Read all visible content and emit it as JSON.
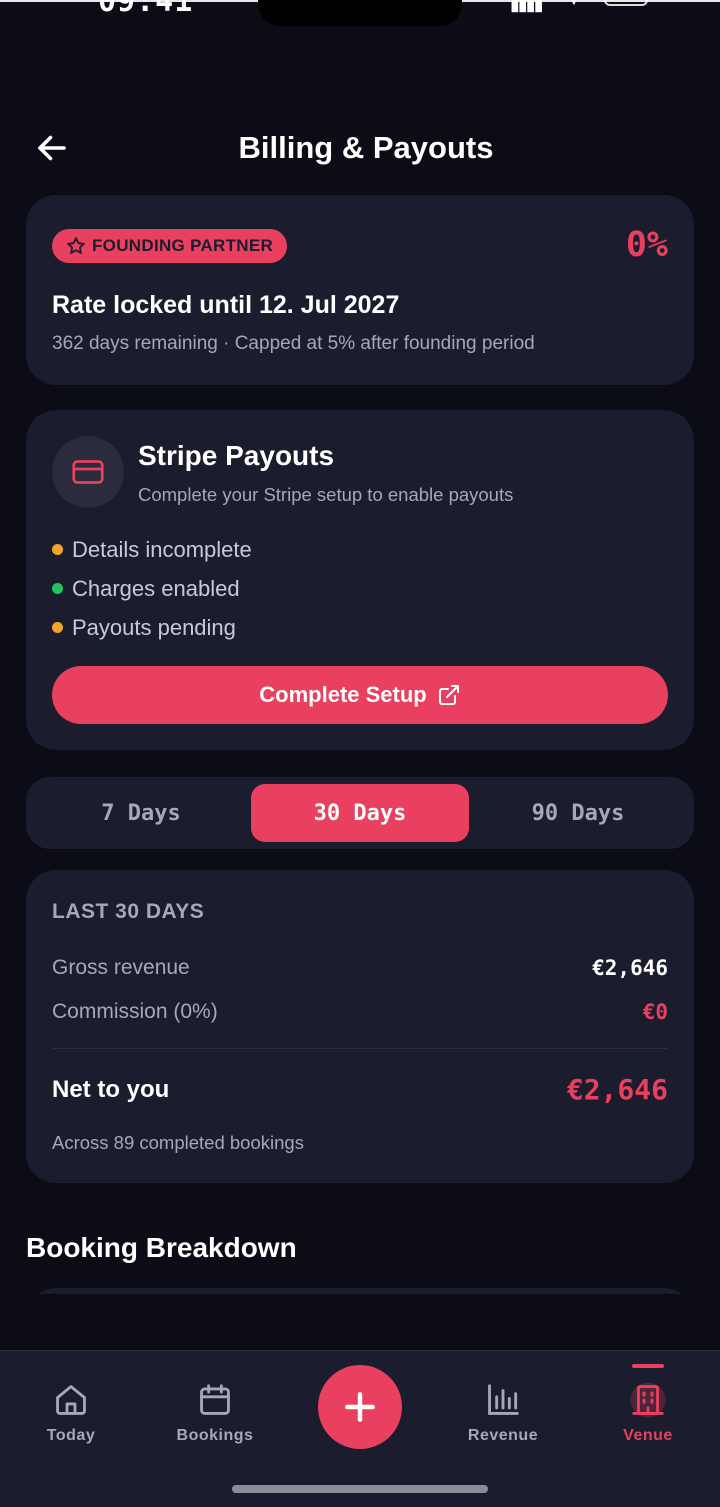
{
  "status_bar": {
    "time": "09:41"
  },
  "header": {
    "title": "Billing & Payouts"
  },
  "founding": {
    "badge": "FOUNDING PARTNER",
    "rate": "0%",
    "locked_text": "Rate locked until 12. Jul 2027",
    "sub_text": "362 days remaining · Capped at 5% after founding period"
  },
  "stripe": {
    "title": "Stripe Payouts",
    "subtitle": "Complete your Stripe setup to enable payouts",
    "statuses": [
      {
        "label": "Details incomplete",
        "color": "#f5a524"
      },
      {
        "label": "Charges enabled",
        "color": "#22c55e"
      },
      {
        "label": "Payouts pending",
        "color": "#f5a524"
      }
    ],
    "button_label": "Complete Setup"
  },
  "period_toggle": {
    "options": [
      "7 Days",
      "30 Days",
      "90 Days"
    ],
    "selected": "30 Days"
  },
  "summary": {
    "heading": "LAST 30 DAYS",
    "gross_label": "Gross revenue",
    "gross_value": "€2,646",
    "commission_label": "Commission (0%)",
    "commission_value": "€0",
    "net_label": "Net to you",
    "net_value": "€2,646",
    "footnote": "Across 89 completed bookings"
  },
  "breakdown": {
    "title": "Booking Breakdown"
  },
  "bottom_nav": {
    "items": [
      {
        "label": "Today",
        "icon": "home-icon"
      },
      {
        "label": "Bookings",
        "icon": "calendar-icon"
      },
      {
        "label": "Revenue",
        "icon": "bar-chart-icon"
      },
      {
        "label": "Venue",
        "icon": "building-icon"
      }
    ],
    "active": "Venue",
    "fab_icon": "plus-icon"
  },
  "colors": {
    "accent": "#e8405e",
    "background": "#0b0c15",
    "card": "#1b1c2e",
    "muted_text": "#a6a8b8"
  }
}
